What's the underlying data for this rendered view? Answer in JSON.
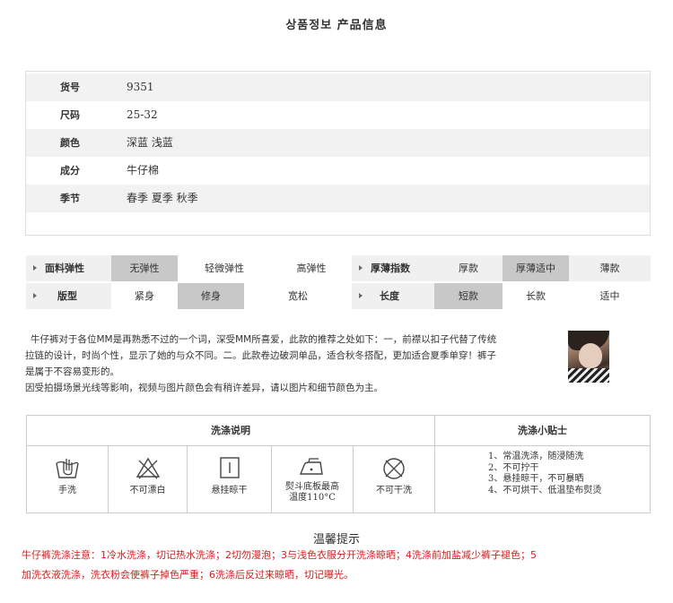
{
  "page_title": "상품정보 产品信息",
  "info": [
    {
      "label": "货号",
      "value": "9351"
    },
    {
      "label": "尺码",
      "value": "25-32"
    },
    {
      "label": "颜色",
      "value": "深蓝 浅蓝"
    },
    {
      "label": "成分",
      "value": "牛仔棉"
    },
    {
      "label": "季节",
      "value": "春季 夏季 秋季"
    }
  ],
  "attributes": {
    "row1": {
      "label1": "面料弹性",
      "opts1": [
        "无弹性",
        "轻微弹性",
        "高弹性"
      ],
      "label2": "厚薄指数",
      "opts2": [
        "厚款",
        "厚薄适中",
        "薄款"
      ]
    },
    "row2": {
      "label1": "版型",
      "opts1": [
        "紧身",
        "修身",
        "宽松"
      ],
      "label2": "长度",
      "opts2": [
        "短款",
        "长款",
        "适中"
      ]
    }
  },
  "description": {
    "line1": "牛仔裤对于各位MM是再熟悉不过的一个词，深受MM所喜爱，此款的推荐之处如下：一，前襟以扣子代替了传统",
    "line2": "拉链的设计，时尚个性，显示了她的与众不同。二。此款卷边破洞单品，适合秋冬搭配，更加适合夏季单穿！裤子",
    "line3": "是属于不容易变形的。",
    "line4": "因受拍摄场景光线等影响，视频与图片颜色会有稍许差异，请以图片和细节颜色为主。"
  },
  "wash": {
    "head_left": "洗涤说明",
    "head_right": "洗涤小贴士",
    "items": [
      {
        "label": "手洗",
        "icon": "hand-wash-icon"
      },
      {
        "label": "不可漂白",
        "icon": "no-bleach-icon"
      },
      {
        "label": "悬挂晾干",
        "icon": "line-dry-icon"
      },
      {
        "label": "熨斗底板最高温度110°C",
        "icon": "iron-icon"
      },
      {
        "label": "不可干洗",
        "icon": "no-dry-clean-icon"
      }
    ],
    "iron_label_line1": "熨斗底板最高",
    "iron_label_line2": "温度110°C",
    "tips": [
      "1、常温洗涤，随浸随洗",
      "2、不可拧干",
      "3、悬挂晾干，不可暴晒",
      "4、不可烘干、低温垫布熨烫"
    ]
  },
  "reminder": {
    "title": "温馨提示",
    "line1": "牛仔裤洗涤注意：1冷水洗涤，切记热水洗涤；2切勿漫泡；3与浅色衣服分开洗涤晾晒；4洗涤前加盐减少裤子褪色；5",
    "line2": "加洗衣液洗涤，洗衣粉会使裤子掉色严重；6洗涤后反过来晾晒，切记曝光。"
  },
  "colors": {
    "accent_red": "#e0191b",
    "selected_gray": "#c8c8c8",
    "row_shade": "#f2f2f2"
  }
}
